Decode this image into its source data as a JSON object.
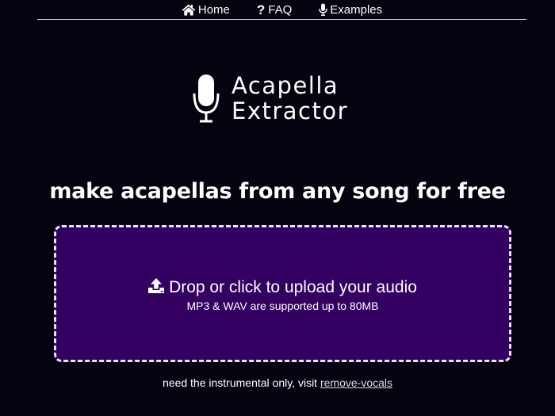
{
  "nav": {
    "items": [
      {
        "label": "Home",
        "icon": "home-icon"
      },
      {
        "label": "FAQ",
        "icon": "question-icon"
      },
      {
        "label": "Examples",
        "icon": "microphone-icon"
      }
    ]
  },
  "logo": {
    "line1": "Acapella",
    "line2": "Extractor",
    "icon": "microphone-icon"
  },
  "headline": "make acapellas from any song for free",
  "upload": {
    "label": "Drop or click to upload your audio",
    "sub": "MP3 & WAV are supported up to 80MB",
    "icon": "upload-icon"
  },
  "footer": {
    "text": "need the instrumental only, visit",
    "link": "remove-vocals"
  },
  "colors": {
    "background": "#04030f",
    "dropzone": "#330062",
    "text": "#ffffff"
  }
}
